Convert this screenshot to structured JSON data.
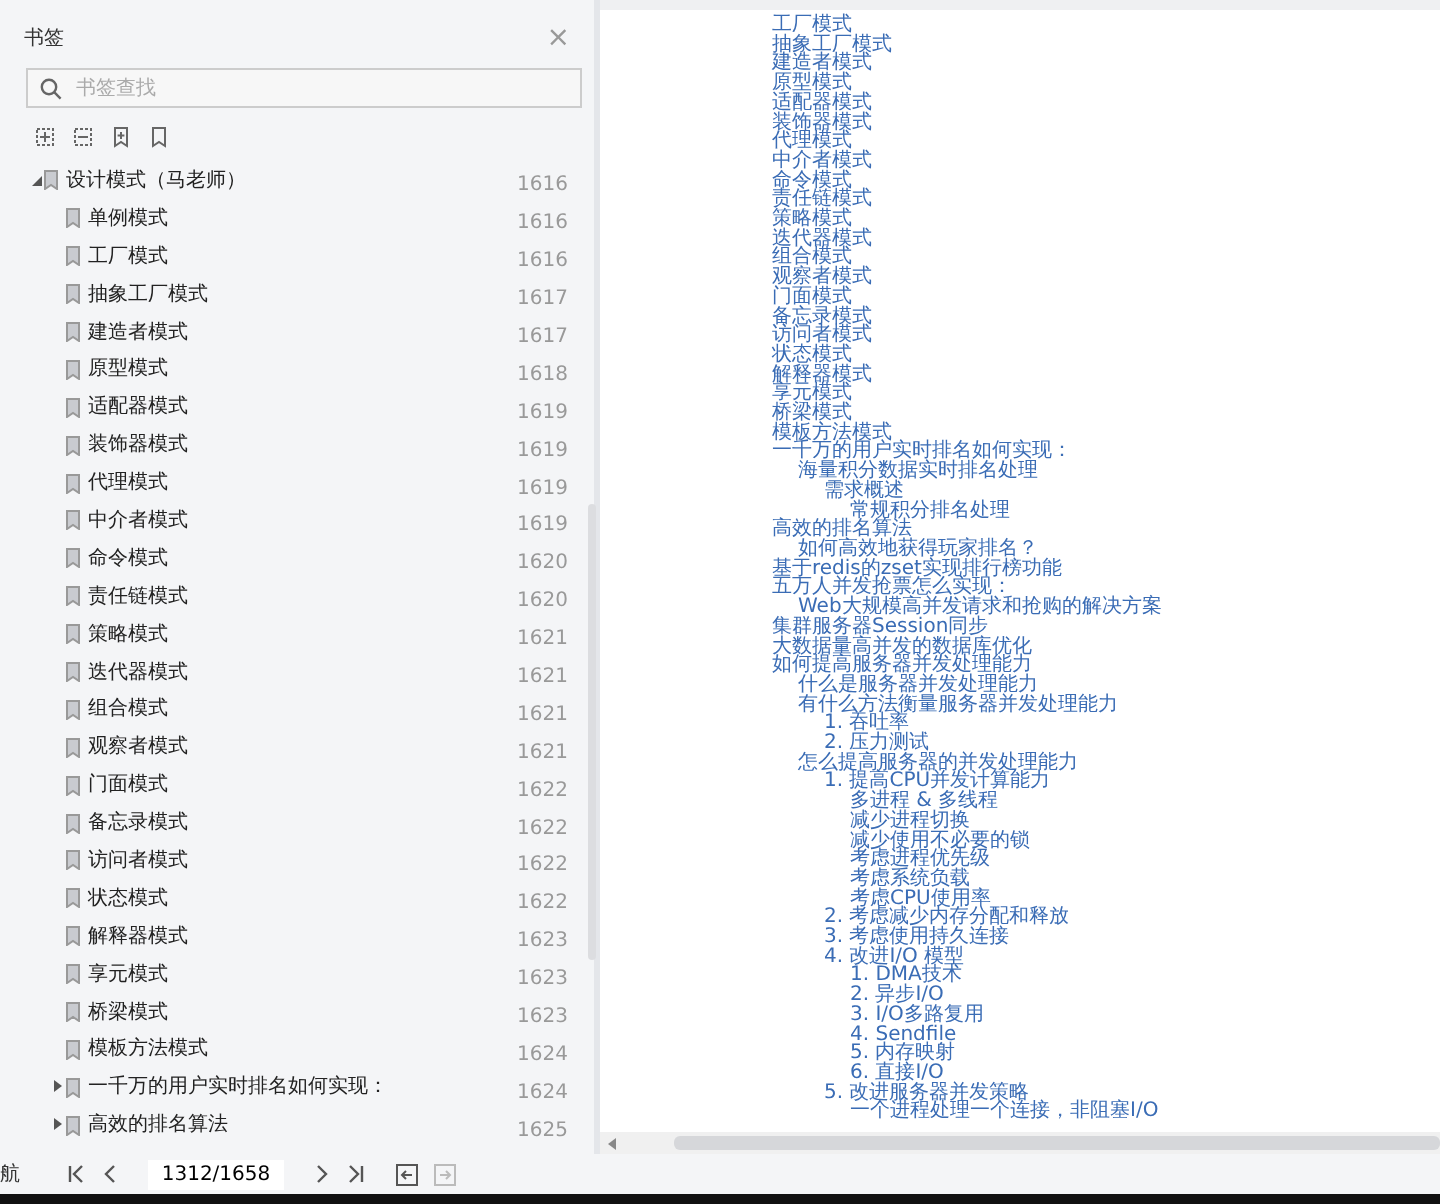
{
  "bookmark_panel": {
    "title": "书签",
    "close": "×",
    "search": {
      "placeholder": "书签查找"
    },
    "tree": [
      {
        "title": "设计模式（马老师）",
        "page": "1616",
        "expanded": true,
        "children": [
          {
            "title": "单例模式",
            "page": "1616"
          },
          {
            "title": "工厂模式",
            "page": "1616"
          },
          {
            "title": "抽象工厂模式",
            "page": "1617"
          },
          {
            "title": "建造者模式",
            "page": "1617"
          },
          {
            "title": "原型模式",
            "page": "1618"
          },
          {
            "title": "适配器模式",
            "page": "1619"
          },
          {
            "title": "装饰器模式",
            "page": "1619"
          },
          {
            "title": "代理模式",
            "page": "1619"
          },
          {
            "title": "中介者模式",
            "page": "1619"
          },
          {
            "title": "命令模式",
            "page": "1620"
          },
          {
            "title": "责任链模式",
            "page": "1620"
          },
          {
            "title": "策略模式",
            "page": "1621"
          },
          {
            "title": "迭代器模式",
            "page": "1621"
          },
          {
            "title": "组合模式",
            "page": "1621"
          },
          {
            "title": "观察者模式",
            "page": "1621"
          },
          {
            "title": "门面模式",
            "page": "1622"
          },
          {
            "title": "备忘录模式",
            "page": "1622"
          },
          {
            "title": "访问者模式",
            "page": "1622"
          },
          {
            "title": "状态模式",
            "page": "1622"
          },
          {
            "title": "解释器模式",
            "page": "1623"
          },
          {
            "title": "享元模式",
            "page": "1623"
          },
          {
            "title": "桥梁模式",
            "page": "1623"
          },
          {
            "title": "模板方法模式",
            "page": "1624"
          },
          {
            "title": "一千万的用户实时排名如何实现：",
            "page": "1624",
            "expanded": false
          },
          {
            "title": "高效的排名算法",
            "page": "1625",
            "expanded": false
          }
        ]
      }
    ]
  },
  "navigation": {
    "label": "航",
    "page_field": "1312/1658"
  },
  "document_toc": [
    {
      "text": "工厂模式"
    },
    {
      "text": "抽象工厂模式"
    },
    {
      "text": "建造者模式"
    },
    {
      "text": "原型模式"
    },
    {
      "text": "适配器模式"
    },
    {
      "text": "装饰器模式"
    },
    {
      "text": "代理模式"
    },
    {
      "text": "中介者模式"
    },
    {
      "text": "命令模式"
    },
    {
      "text": "责任链模式"
    },
    {
      "text": "策略模式"
    },
    {
      "text": "迭代器模式"
    },
    {
      "text": "组合模式"
    },
    {
      "text": "观察者模式"
    },
    {
      "text": "门面模式"
    },
    {
      "text": "备忘录模式"
    },
    {
      "text": "访问者模式"
    },
    {
      "text": "状态模式"
    },
    {
      "text": "解释器模式"
    },
    {
      "text": "享元模式"
    },
    {
      "text": "桥梁模式"
    },
    {
      "text": "模板方法模式"
    },
    {
      "text": "一千万的用户实时排名如何实现：",
      "children": [
        {
          "text": "海量积分数据实时排名处理",
          "children": [
            {
              "text": "需求概述",
              "children": [
                {
                  "text": "常规积分排名处理"
                }
              ]
            }
          ]
        }
      ]
    },
    {
      "text": "高效的排名算法",
      "children": [
        {
          "text": "如何高效地获得玩家排名？"
        }
      ]
    },
    {
      "text": "基于redis的zset实现排行榜功能"
    },
    {
      "text": "五万人并发抢票怎么实现：",
      "children": [
        {
          "text": "Web大规模高并发请求和抢购的解决方案"
        }
      ]
    },
    {
      "text": "集群服务器Session同步"
    },
    {
      "text": "大数据量高并发的数据库优化"
    },
    {
      "text": "如何提高服务器并发处理能力",
      "children": [
        {
          "text": "什么是服务器并发处理能力"
        },
        {
          "text": "有什么方法衡量服务器并发处理能力",
          "children": [
            {
              "text": "1. 吞吐率"
            },
            {
              "text": "2. 压力测试"
            }
          ]
        },
        {
          "text": "怎么提高服务器的并发处理能力",
          "children": [
            {
              "text": "1. 提高CPU并发计算能力",
              "children": [
                {
                  "text": "多进程 & 多线程"
                },
                {
                  "text": "减少进程切换"
                },
                {
                  "text": "减少使用不必要的锁"
                },
                {
                  "text": "考虑进程优先级"
                },
                {
                  "text": "考虑系统负载"
                },
                {
                  "text": "考虑CPU使用率"
                }
              ]
            },
            {
              "text": "2. 考虑减少内存分配和释放"
            },
            {
              "text": "3. 考虑使用持久连接"
            },
            {
              "text": "4. 改进I/O 模型",
              "children": [
                {
                  "text": "1. DMA技术"
                },
                {
                  "text": "2. 异步I/O"
                },
                {
                  "text": "3. I/O多路复用"
                },
                {
                  "text": "4. Sendfile"
                },
                {
                  "text": "5. 内存映射"
                },
                {
                  "text": "6. 直接I/O"
                }
              ]
            },
            {
              "text": "5. 改进服务器并发策略",
              "children": [
                {
                  "text": "一个进程处理一个连接，非阻塞I/O"
                }
              ]
            }
          ]
        }
      ]
    }
  ]
}
